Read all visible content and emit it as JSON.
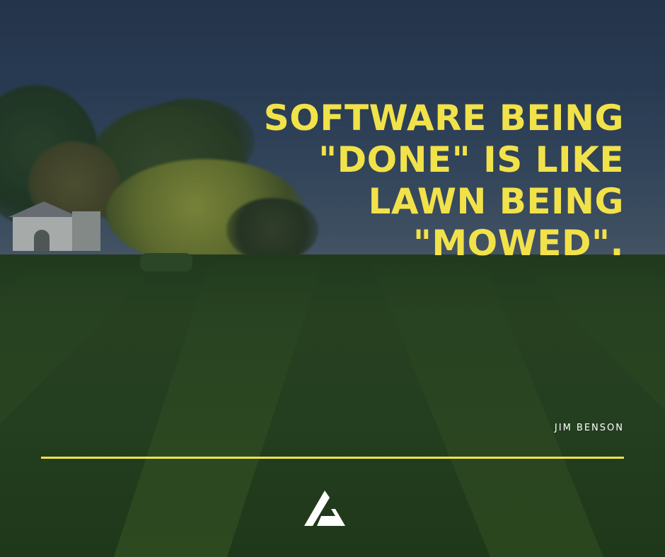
{
  "quote": {
    "lines": [
      "SOFTWARE BEING",
      "\"DONE\" IS LIKE",
      "LAWN BEING",
      "\"MOWED\"."
    ]
  },
  "author": "JIM BENSON",
  "colors": {
    "accent": "#f2e24a",
    "author_text": "#ffffff",
    "logo": "#ffffff"
  },
  "logo": {
    "icon": "triangle-logo-icon"
  }
}
